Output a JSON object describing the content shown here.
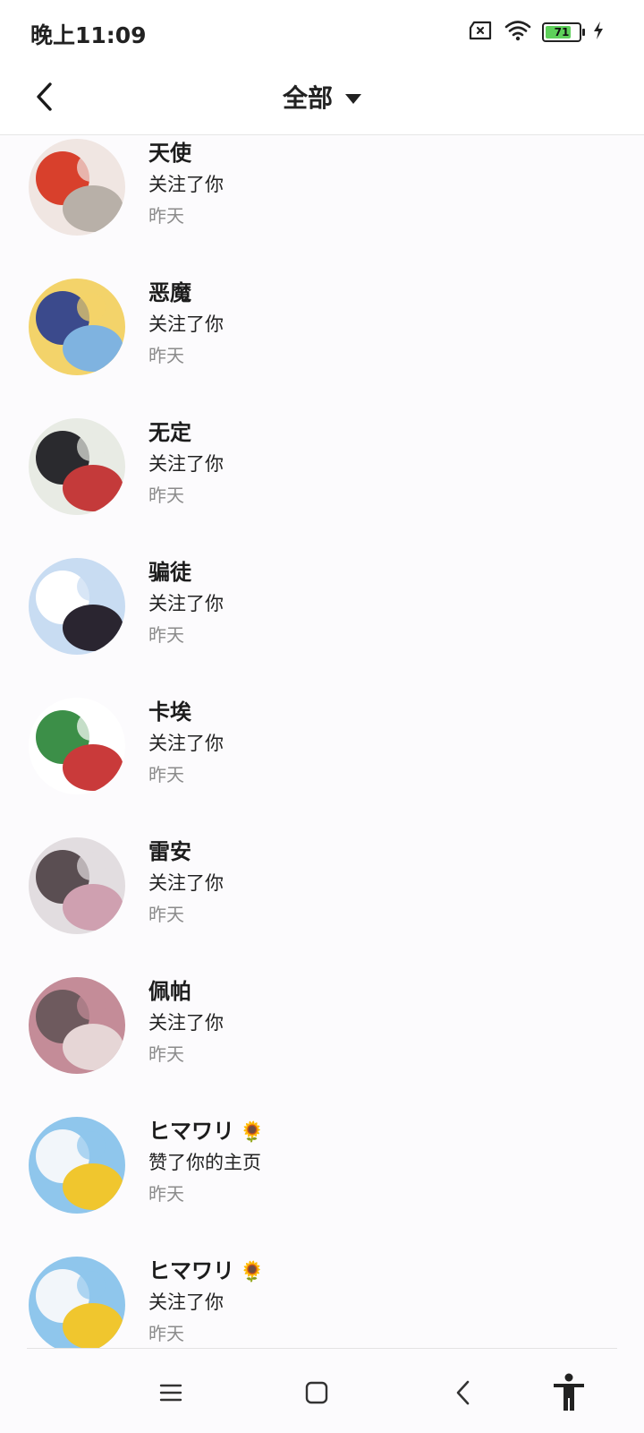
{
  "status_bar": {
    "time": "晚上11:09",
    "battery_level": "71",
    "icons": [
      "sim-error-icon",
      "wifi-icon",
      "battery-icon",
      "charging-bolt-icon"
    ],
    "battery_color": "#5ed05a"
  },
  "header": {
    "title": "全部",
    "back_icon": "chevron-left-icon",
    "dropdown_icon": "caret-down-icon"
  },
  "notifications": [
    {
      "name": "天使",
      "action": "关注了你",
      "time": "昨天",
      "avatar_colors": [
        "#f0e6e2",
        "#d8402c",
        "#b8b0a8"
      ]
    },
    {
      "name": "恶魔",
      "action": "关注了你",
      "time": "昨天",
      "avatar_colors": [
        "#f3d36a",
        "#3b4a8c",
        "#7fb3e0"
      ]
    },
    {
      "name": "无定",
      "action": "关注了你",
      "time": "昨天",
      "avatar_colors": [
        "#e8ebe4",
        "#2a2a2e",
        "#c43a3a"
      ]
    },
    {
      "name": "骗徒",
      "action": "关注了你",
      "time": "昨天",
      "avatar_colors": [
        "#c8dcf2",
        "#ffffff",
        "#2a2530"
      ]
    },
    {
      "name": "卡埃",
      "action": "关注了你",
      "time": "昨天",
      "avatar_colors": [
        "#ffffff",
        "#3c8f48",
        "#c93a3a"
      ]
    },
    {
      "name": "雷安",
      "action": "关注了你",
      "time": "昨天",
      "avatar_colors": [
        "#e2dde0",
        "#5a4e52",
        "#cfa0b0"
      ]
    },
    {
      "name": "佩帕",
      "action": "关注了你",
      "time": "昨天",
      "avatar_colors": [
        "#c48c98",
        "#6e5a5e",
        "#e6d6d6"
      ]
    },
    {
      "name": "ヒマワリ",
      "name_emoji": "🌻",
      "action": "赞了你的主页",
      "time": "昨天",
      "avatar_colors": [
        "#8fc6ec",
        "#f2f6fa",
        "#f0c62e"
      ]
    },
    {
      "name": "ヒマワリ",
      "name_emoji": "🌻",
      "action": "关注了你",
      "time": "昨天",
      "avatar_colors": [
        "#8fc6ec",
        "#f2f6fa",
        "#f0c62e"
      ]
    }
  ],
  "nav_bar": {
    "buttons": [
      "menu-icon",
      "home-square-icon",
      "back-chevron-icon",
      "accessibility-icon"
    ]
  }
}
